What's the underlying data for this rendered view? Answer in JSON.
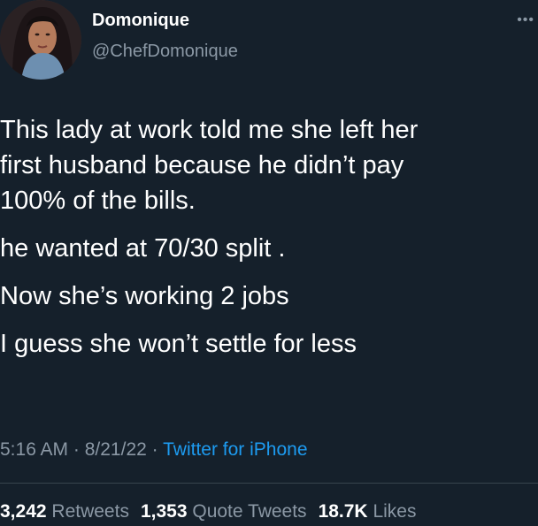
{
  "author": {
    "display_name": "Domonique",
    "handle": "@ChefDomonique",
    "avatar_icon": "user-avatar-photo"
  },
  "more_icon": "more-options-icon",
  "tweet": {
    "lines": [
      "This lady at work told me she left her first husband because he didn’t pay 100% of the bills.",
      "he wanted at 70/30 split .",
      "Now she’s working 2 jobs",
      "I guess she won’t settle for less"
    ]
  },
  "meta": {
    "time": "5:16 AM",
    "separator": " · ",
    "date": "8/21/22",
    "source": "Twitter for iPhone"
  },
  "stats": {
    "retweets_count": "3,242",
    "retweets_label": "Retweets",
    "quotes_count": "1,353",
    "quotes_label": "Quote Tweets",
    "likes_count": "18.7K",
    "likes_label": "Likes"
  },
  "colors": {
    "background": "#15202b",
    "text": "#ffffff",
    "secondary": "#8b98a5",
    "link": "#1d9bf0",
    "divider": "#38444d"
  }
}
